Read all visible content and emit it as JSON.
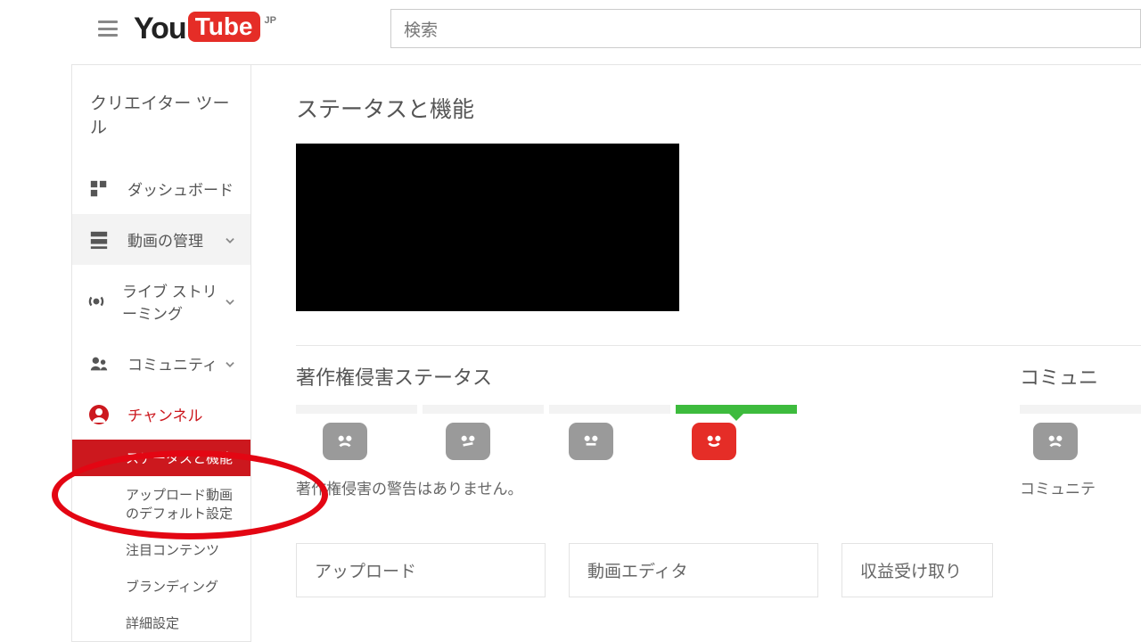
{
  "header": {
    "logo_you": "You",
    "logo_tube": "Tube",
    "region": "JP",
    "search_placeholder": "検索"
  },
  "sidebar": {
    "title": "クリエイター ツール",
    "items": [
      {
        "label": "ダッシュボード",
        "icon": "dashboard-icon",
        "expandable": false
      },
      {
        "label": "動画の管理",
        "icon": "videos-icon",
        "expandable": true
      },
      {
        "label": "ライブ ストリーミング",
        "icon": "live-icon",
        "expandable": true
      },
      {
        "label": "コミュニティ",
        "icon": "community-icon",
        "expandable": true
      },
      {
        "label": "チャンネル",
        "icon": "channel-icon",
        "expandable": false,
        "red": true
      }
    ],
    "subitems": [
      {
        "label": "ステータスと機能",
        "active": true
      },
      {
        "label": "アップロード動画のデフォルト設定",
        "active": false
      },
      {
        "label": "注目コンテンツ",
        "active": false
      },
      {
        "label": "ブランディング",
        "active": false
      },
      {
        "label": "詳細設定",
        "active": false
      }
    ]
  },
  "main": {
    "title": "ステータスと機能",
    "copyright": {
      "heading": "著作権侵害ステータス",
      "note": "著作権侵害の警告はありません。"
    },
    "community": {
      "heading_partial": "コミュニ",
      "note_partial": "コミュニテ"
    },
    "cards": [
      "アップロード",
      "動画エディタ",
      "収益受け取り"
    ]
  }
}
